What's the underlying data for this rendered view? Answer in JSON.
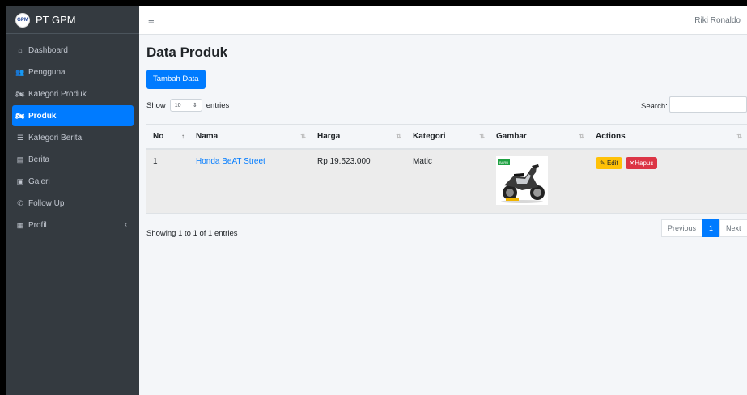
{
  "brand": {
    "logo_text": "GPM",
    "name": "PT GPM"
  },
  "sidebar": {
    "items": [
      {
        "label": "Dashboard",
        "icon": "home-icon",
        "glyph": "⌂"
      },
      {
        "label": "Pengguna",
        "icon": "users-icon",
        "glyph": "👥"
      },
      {
        "label": "Kategori Produk",
        "icon": "motorcycle-icon",
        "glyph": "🏍"
      },
      {
        "label": "Produk",
        "icon": "motorcycle-icon",
        "glyph": "🏍"
      },
      {
        "label": "Kategori Berita",
        "icon": "list-icon",
        "glyph": "☰"
      },
      {
        "label": "Berita",
        "icon": "newspaper-icon",
        "glyph": "▤"
      },
      {
        "label": "Galeri",
        "icon": "image-icon",
        "glyph": "▣"
      },
      {
        "label": "Follow Up",
        "icon": "phone-icon",
        "glyph": "✆"
      },
      {
        "label": "Profil",
        "icon": "building-icon",
        "glyph": "▦"
      }
    ],
    "profil_arrow": "‹"
  },
  "topbar": {
    "menu_glyph": "≡",
    "user": "Riki Ronaldo"
  },
  "page": {
    "title": "Data Produk",
    "add_button": "Tambah Data",
    "show_label": "Show",
    "entries_label": "entries",
    "page_length": "10",
    "search_label": "Search:"
  },
  "table": {
    "headers": [
      "No",
      "Nama",
      "Harga",
      "Kategori",
      "Gambar",
      "Actions"
    ],
    "rows": [
      {
        "no": "1",
        "nama": "Honda BeAT Street",
        "harga": "Rp 19.523.000",
        "kategori": "Matic",
        "badge": "BARU",
        "edit": "Edit",
        "hapus": "Hapus"
      }
    ]
  },
  "footer": {
    "info": "Showing 1 to 1 of 1 entries",
    "previous": "Previous",
    "current_page": "1",
    "next": "Next"
  },
  "colors": {
    "primary": "#007bff",
    "sidebar": "#343a40",
    "warning": "#ffc107",
    "danger": "#dc3545"
  }
}
